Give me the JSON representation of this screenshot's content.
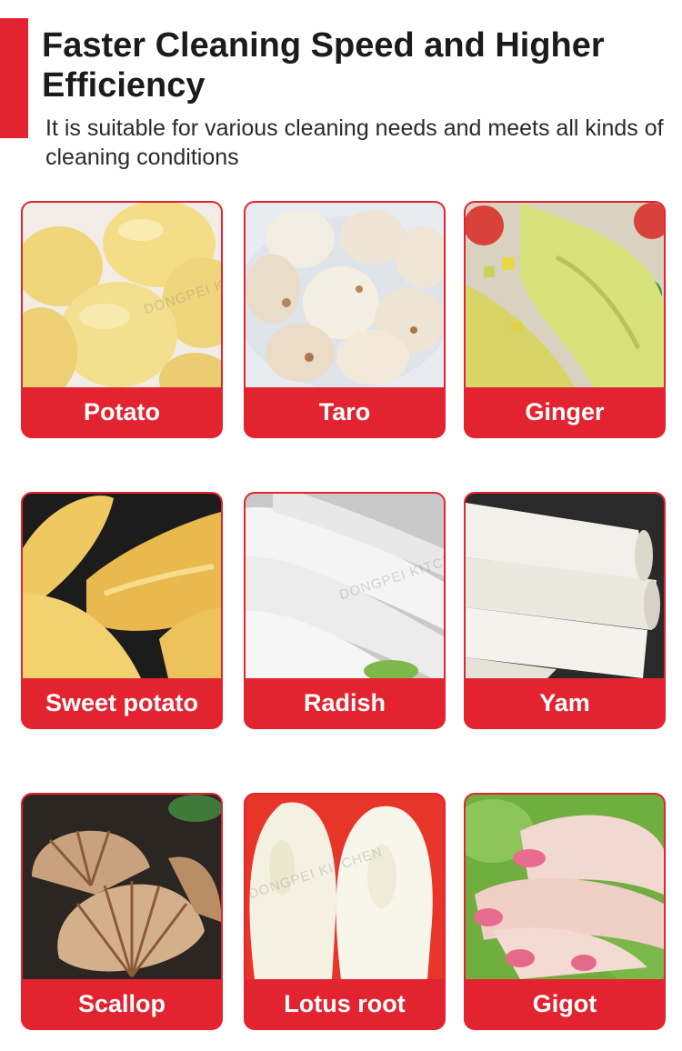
{
  "header": {
    "title": "Faster Cleaning Speed and Higher Efficiency",
    "subtitle": "It is suitable for various cleaning needs and meets all kinds of cleaning conditions"
  },
  "colors": {
    "accent": "#e3232f",
    "label_text": "#ffffff"
  },
  "watermark": "DONGPEI KITCHEN",
  "items": [
    {
      "label": "Potato",
      "icon": "potato-photo"
    },
    {
      "label": "Taro",
      "icon": "taro-photo"
    },
    {
      "label": "Ginger",
      "icon": "ginger-photo"
    },
    {
      "label": "Sweet potato",
      "icon": "sweet-potato-photo"
    },
    {
      "label": "Radish",
      "icon": "radish-photo"
    },
    {
      "label": "Yam",
      "icon": "yam-photo"
    },
    {
      "label": "Scallop",
      "icon": "scallop-photo"
    },
    {
      "label": "Lotus root",
      "icon": "lotus-root-photo"
    },
    {
      "label": "Gigot",
      "icon": "gigot-photo"
    }
  ]
}
